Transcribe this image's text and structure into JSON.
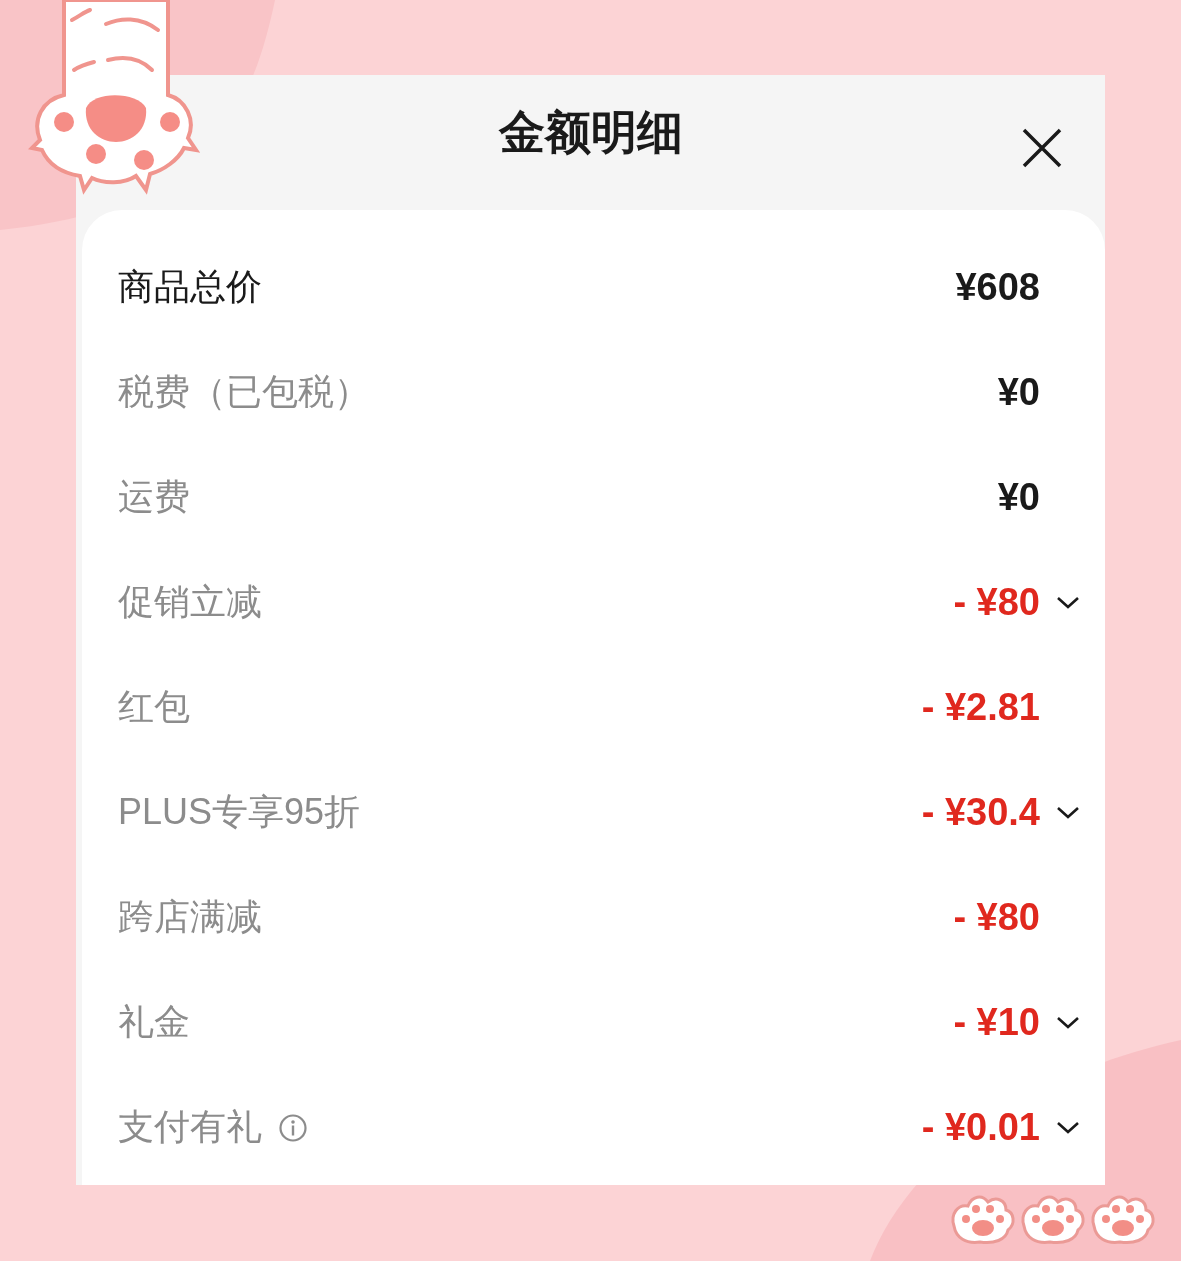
{
  "title": "金额明细",
  "rows": [
    {
      "label": "商品总价",
      "emphasis": true,
      "value": "¥608",
      "kind": "charge",
      "expandable": false,
      "info": false
    },
    {
      "label": "税费（已包税）",
      "emphasis": false,
      "value": "¥0",
      "kind": "charge",
      "expandable": false,
      "info": false
    },
    {
      "label": "运费",
      "emphasis": false,
      "value": "¥0",
      "kind": "charge",
      "expandable": false,
      "info": false
    },
    {
      "label": "促销立减",
      "emphasis": false,
      "value": "- ¥80",
      "kind": "discount",
      "expandable": true,
      "info": false
    },
    {
      "label": "红包",
      "emphasis": false,
      "value": "- ¥2.81",
      "kind": "discount",
      "expandable": false,
      "info": false
    },
    {
      "label": "PLUS专享95折",
      "emphasis": false,
      "value": "- ¥30.4",
      "kind": "discount",
      "expandable": true,
      "info": false
    },
    {
      "label": "跨店满减",
      "emphasis": false,
      "value": "- ¥80",
      "kind": "discount",
      "expandable": false,
      "info": false
    },
    {
      "label": "礼金",
      "emphasis": false,
      "value": "- ¥10",
      "kind": "discount",
      "expandable": true,
      "info": false
    },
    {
      "label": "支付有礼",
      "emphasis": false,
      "value": "- ¥0.01",
      "kind": "discount",
      "expandable": true,
      "info": true
    }
  ]
}
